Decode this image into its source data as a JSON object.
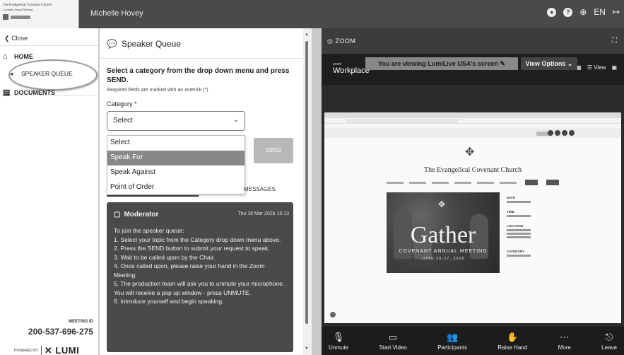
{
  "topbar": {
    "logo_line1": "The Evangelical Covenant Church",
    "logo_line2": "Covenant Annual Meeting",
    "user_name": "Michelle Hovey",
    "lang": "EN"
  },
  "sidebar": {
    "close_label": "Close",
    "items": [
      {
        "label": "HOME",
        "icon": "home-icon"
      },
      {
        "label": "SPEAKER QUEUE",
        "icon": "speaker-icon"
      },
      {
        "label": "DOCUMENTS",
        "icon": "document-icon"
      }
    ],
    "meeting_label": "MEETING ID",
    "meeting_id": "200-537-696-275",
    "powered_by": "POWERED BY",
    "brand": "LUMI"
  },
  "speaker_queue": {
    "title": "Speaker Queue",
    "instruction": "Select a category from the drop down menu and press SEND.",
    "required_note": "Required fields are marked with an asterisk (*)",
    "category_label": "Category *",
    "select_value": "Select",
    "options": [
      "Select",
      "Speak For",
      "Speak Against",
      "Point of Order"
    ],
    "selected_option": "Speak For",
    "send_label": "SEND",
    "messages_tab": "MESSAGES",
    "moderator": {
      "name": "Moderator",
      "timestamp": "Thu 19 Mar 2026 15:13",
      "lines": [
        "To join the speaker queue:",
        "1. Select your topic from the Category drop down menu above.",
        "2. Press the SEND button to submit your request to speak.",
        "3. Wait to be called upon by the Chair.",
        "4. Once called upon, please raise your hand in the Zoom Meeting.",
        "5. The production team will ask you to unmute your microphone. You will receive a pop up window - press UNMUTE.",
        "6. Introduce yourself and begin speaking."
      ]
    }
  },
  "zoom": {
    "title": "ZOOM",
    "app_small": "zoom",
    "app_name": "Workplace",
    "view_label": "View",
    "viewing_banner": "You are viewing LumiLive USA's screen",
    "view_options": "View Options",
    "church_name": "The Evangelical Covenant Church",
    "poster_title": "Gather",
    "poster_subtitle": "COVENANT ANNUAL MEETING",
    "poster_dates": "JUNE 26-27, 2026",
    "info_labels": [
      "DATE",
      "TIME",
      "LOCATION",
      "CATEGORY"
    ],
    "controls": [
      {
        "label": "Unmute",
        "icon": "microphone-icon",
        "glyph": "🎙"
      },
      {
        "label": "Start Video",
        "icon": "video-icon",
        "glyph": "▭"
      },
      {
        "label": "Participants",
        "icon": "participants-icon",
        "glyph": "👥"
      },
      {
        "label": "Raise Hand",
        "icon": "hand-icon",
        "glyph": "✋"
      },
      {
        "label": "More",
        "icon": "more-icon",
        "glyph": "⋯"
      },
      {
        "label": "Leave",
        "icon": "leave-icon",
        "glyph": "⎋"
      }
    ]
  }
}
